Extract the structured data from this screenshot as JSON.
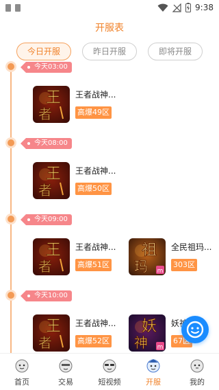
{
  "status_bar": {
    "time": "9:38"
  },
  "header": {
    "title": "开服表"
  },
  "tabs": [
    {
      "label": "今日开服",
      "active": true
    },
    {
      "label": "昨日开服",
      "active": false
    },
    {
      "label": "即将开服",
      "active": false
    }
  ],
  "timeline": [
    {
      "time": "今天03:00",
      "games": [
        {
          "name": "王者战神...",
          "zone": "高爆49区",
          "icon": "wangzhe-game-icon"
        }
      ]
    },
    {
      "time": "今天08:00",
      "games": [
        {
          "name": "王者战神...",
          "zone": "高爆50区",
          "icon": "wangzhe-game-icon"
        }
      ]
    },
    {
      "time": "今天09:00",
      "games": [
        {
          "name": "王者战神...",
          "zone": "高爆51区",
          "icon": "wangzhe-game-icon"
        },
        {
          "name": "全民祖玛...",
          "zone": "303区",
          "icon": "zuma-game-icon"
        }
      ]
    },
    {
      "time": "今天10:00",
      "games": [
        {
          "name": "王者战神...",
          "zone": "高爆52区",
          "icon": "wangzhe-game-icon"
        },
        {
          "name": "妖神...",
          "zone": "67区",
          "icon": "yaoshen-game-icon"
        }
      ]
    }
  ],
  "game_icon_text": {
    "wangzhe": [
      "王",
      "者"
    ],
    "zuma": [
      "祖",
      "玛"
    ],
    "yaoshen": [
      "妖",
      "神"
    ]
  },
  "bottom_nav": [
    {
      "label": "首页",
      "active": false
    },
    {
      "label": "交易",
      "active": false
    },
    {
      "label": "短视频",
      "active": false
    },
    {
      "label": "开服",
      "active": true
    },
    {
      "label": "我的",
      "active": false
    }
  ],
  "colors": {
    "accent": "#f0822a",
    "tag": "#f6868a",
    "zone_badge": "#ff9444",
    "fab": "#1a8cff"
  }
}
